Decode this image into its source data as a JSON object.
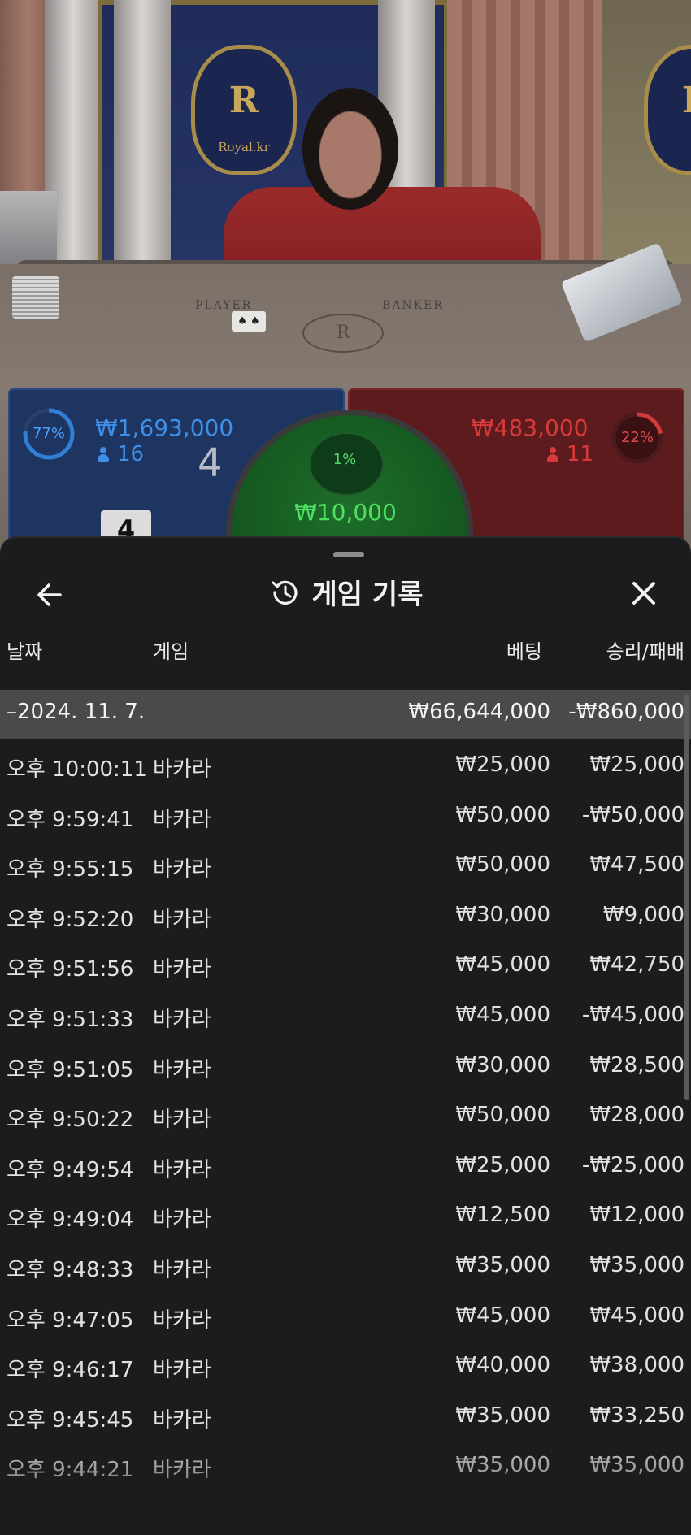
{
  "stream": {
    "brand": "Royal.kr",
    "crest_letter": "R",
    "felt_player": "PLAYER",
    "felt_banker": "BANKER"
  },
  "player": {
    "percent": "77%",
    "percent_value": 77,
    "amount": "₩1,693,000",
    "count": "16",
    "score": "4",
    "card": "4",
    "color": "#2f7fd6"
  },
  "tie": {
    "percent": "1%",
    "amount": "₩10,000"
  },
  "banker": {
    "percent": "22%",
    "percent_value": 22,
    "amount": "₩483,000",
    "count": "11",
    "color": "#d23a3a"
  },
  "sheet": {
    "title": "게임 기록",
    "icons": {
      "back": "back-arrow-icon",
      "history": "history-icon",
      "close": "close-icon"
    },
    "headers": {
      "date": "날짜",
      "game": "게임",
      "bet": "베팅",
      "result": "승리/패배"
    },
    "date_group": {
      "date": "–2024. 11. 7.",
      "bet_total": "₩66,644,000",
      "result_total": "-₩860,000"
    },
    "rows": [
      {
        "time": "오후 10:00:11",
        "game": "바카라",
        "bet": "₩25,000",
        "result": "₩25,000"
      },
      {
        "time": "오후 9:59:41",
        "game": "바카라",
        "bet": "₩50,000",
        "result": "-₩50,000"
      },
      {
        "time": "오후 9:55:15",
        "game": "바카라",
        "bet": "₩50,000",
        "result": "₩47,500"
      },
      {
        "time": "오후 9:52:20",
        "game": "바카라",
        "bet": "₩30,000",
        "result": "₩9,000"
      },
      {
        "time": "오후 9:51:56",
        "game": "바카라",
        "bet": "₩45,000",
        "result": "₩42,750"
      },
      {
        "time": "오후 9:51:33",
        "game": "바카라",
        "bet": "₩45,000",
        "result": "-₩45,000"
      },
      {
        "time": "오후 9:51:05",
        "game": "바카라",
        "bet": "₩30,000",
        "result": "₩28,500"
      },
      {
        "time": "오후 9:50:22",
        "game": "바카라",
        "bet": "₩50,000",
        "result": "₩28,000"
      },
      {
        "time": "오후 9:49:54",
        "game": "바카라",
        "bet": "₩25,000",
        "result": "-₩25,000"
      },
      {
        "time": "오후 9:49:04",
        "game": "바카라",
        "bet": "₩12,500",
        "result": "₩12,000"
      },
      {
        "time": "오후 9:48:33",
        "game": "바카라",
        "bet": "₩35,000",
        "result": "₩35,000"
      },
      {
        "time": "오후 9:47:05",
        "game": "바카라",
        "bet": "₩45,000",
        "result": "₩45,000"
      },
      {
        "time": "오후 9:46:17",
        "game": "바카라",
        "bet": "₩40,000",
        "result": "₩38,000"
      },
      {
        "time": "오후 9:45:45",
        "game": "바카라",
        "bet": "₩35,000",
        "result": "₩33,250"
      },
      {
        "time": "오후 9:44:21",
        "game": "바카라",
        "bet": "₩35,000",
        "result": "₩35,000"
      }
    ]
  }
}
